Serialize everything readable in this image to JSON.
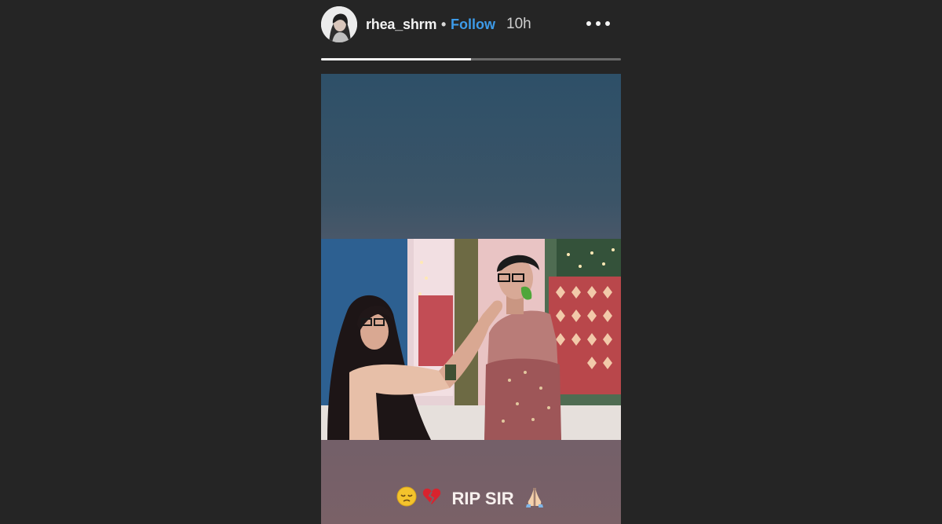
{
  "header": {
    "username": "rhea_shrm",
    "separator": "•",
    "follow_label": "Follow",
    "time_ago": "10h",
    "more_icon": "more-horizontal-icon"
  },
  "progress": {
    "segments": 2,
    "current_fraction": 0.5
  },
  "story": {
    "caption_text": "RIP SIR",
    "caption_emojis_before": [
      "pensive-face-emoji",
      "broken-heart-emoji"
    ],
    "caption_emojis_after": [
      "folded-hands-emoji"
    ]
  },
  "colors": {
    "background": "#252525",
    "follow_blue": "#3d9be9",
    "progress_fill": "#f2f2f2",
    "progress_track": "#6a6a6a"
  }
}
